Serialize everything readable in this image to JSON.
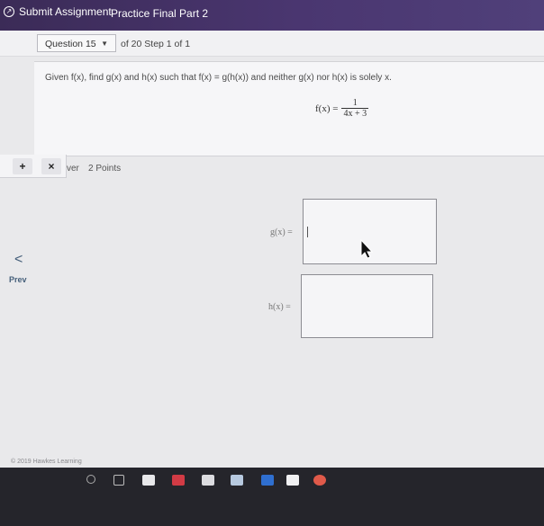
{
  "topbar": {
    "submit_label": "Submit Assignment",
    "title": "Practice Final Part 2"
  },
  "nav": {
    "question_select": "Question 15",
    "position_text": "of 20 Step 1 of 1"
  },
  "question": {
    "prompt": "Given f(x), find g(x) and h(x) such that f(x) = g(h(x)) and neither g(x) nor h(x) is solely x.",
    "fx_lhs": "f(x) =",
    "fx_numerator": "1",
    "fx_denominator": "4x + 3"
  },
  "answer_toolbar": {
    "add_label": "+",
    "close_label": "×"
  },
  "answer": {
    "label_fragment": "ver",
    "points": "2 Points",
    "g_label": "g(x) =",
    "h_label": "h(x) ="
  },
  "prev": {
    "arrow": "<",
    "label": "Prev"
  },
  "footer": {
    "copyright": "© 2019 Hawkes Learning"
  },
  "colors": {
    "topbar_start": "#3b2b57",
    "topbar_end": "#50407a",
    "prev_text": "#455f7a"
  }
}
